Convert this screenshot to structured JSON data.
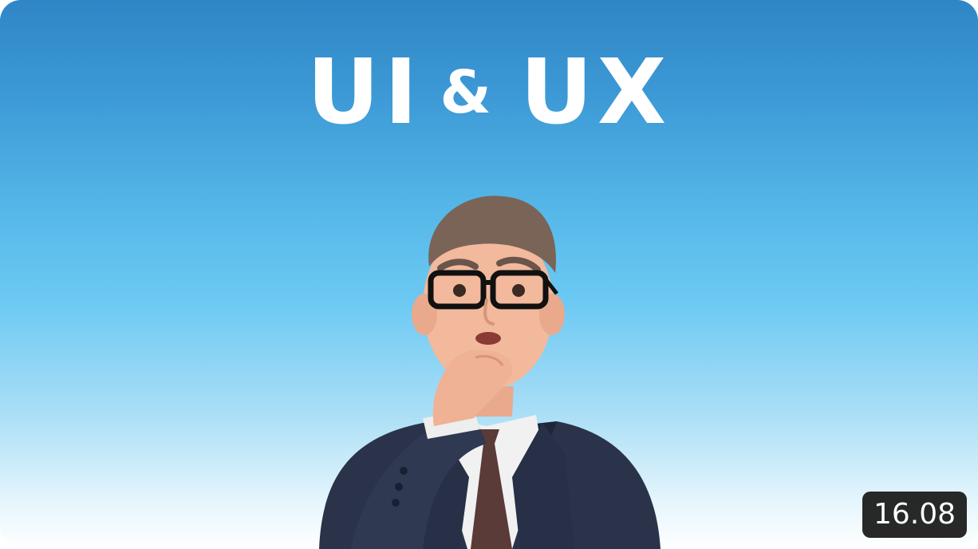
{
  "thumbnail": {
    "title_left": "UI",
    "title_amp": "&",
    "title_right": "UX",
    "duration": "16.08"
  },
  "colors": {
    "sky_top": "#2f86c6",
    "sky_mid": "#6cc9f3",
    "sky_bottom": "#ffffff",
    "badge_bg": "#161616",
    "title_text": "#ffffff"
  },
  "icons": {
    "character": "thinking-businessman-3d-icon"
  }
}
